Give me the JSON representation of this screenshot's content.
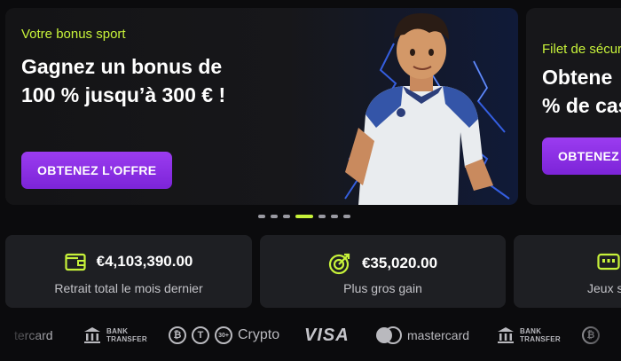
{
  "promos": [
    {
      "kicker": "Votre bonus sport",
      "headline": "Gagnez un bonus de 100 % jusqu’à 300 € !",
      "cta": "OBTENEZ L’OFFRE"
    },
    {
      "kicker": "Filet de sécuri",
      "headline_line1": "Obtene",
      "headline_line2": "% de cas",
      "cta": "OBTENEZ"
    }
  ],
  "carousel": {
    "total": 7,
    "active_index": 3
  },
  "stats": [
    {
      "icon": "wallet-icon",
      "value": "€4,103,390.00",
      "label": "Retrait total le mois dernier"
    },
    {
      "icon": "target-icon",
      "value": "€35,020.00",
      "label": "Plus gros gain"
    },
    {
      "icon": "game-icon",
      "value": "",
      "label": "Jeux s"
    }
  ],
  "payments": {
    "mastercard_cut": "tercard",
    "bank_line1": "BANK",
    "bank_line2": "TRANSFER",
    "crypto": "Crypto",
    "visa": "VISA",
    "mastercard": "mastercard"
  },
  "colors": {
    "accent": "#c7f23a",
    "cta": "#8a2fe6",
    "card": "#1e1f23",
    "background": "#0b0b0d"
  }
}
